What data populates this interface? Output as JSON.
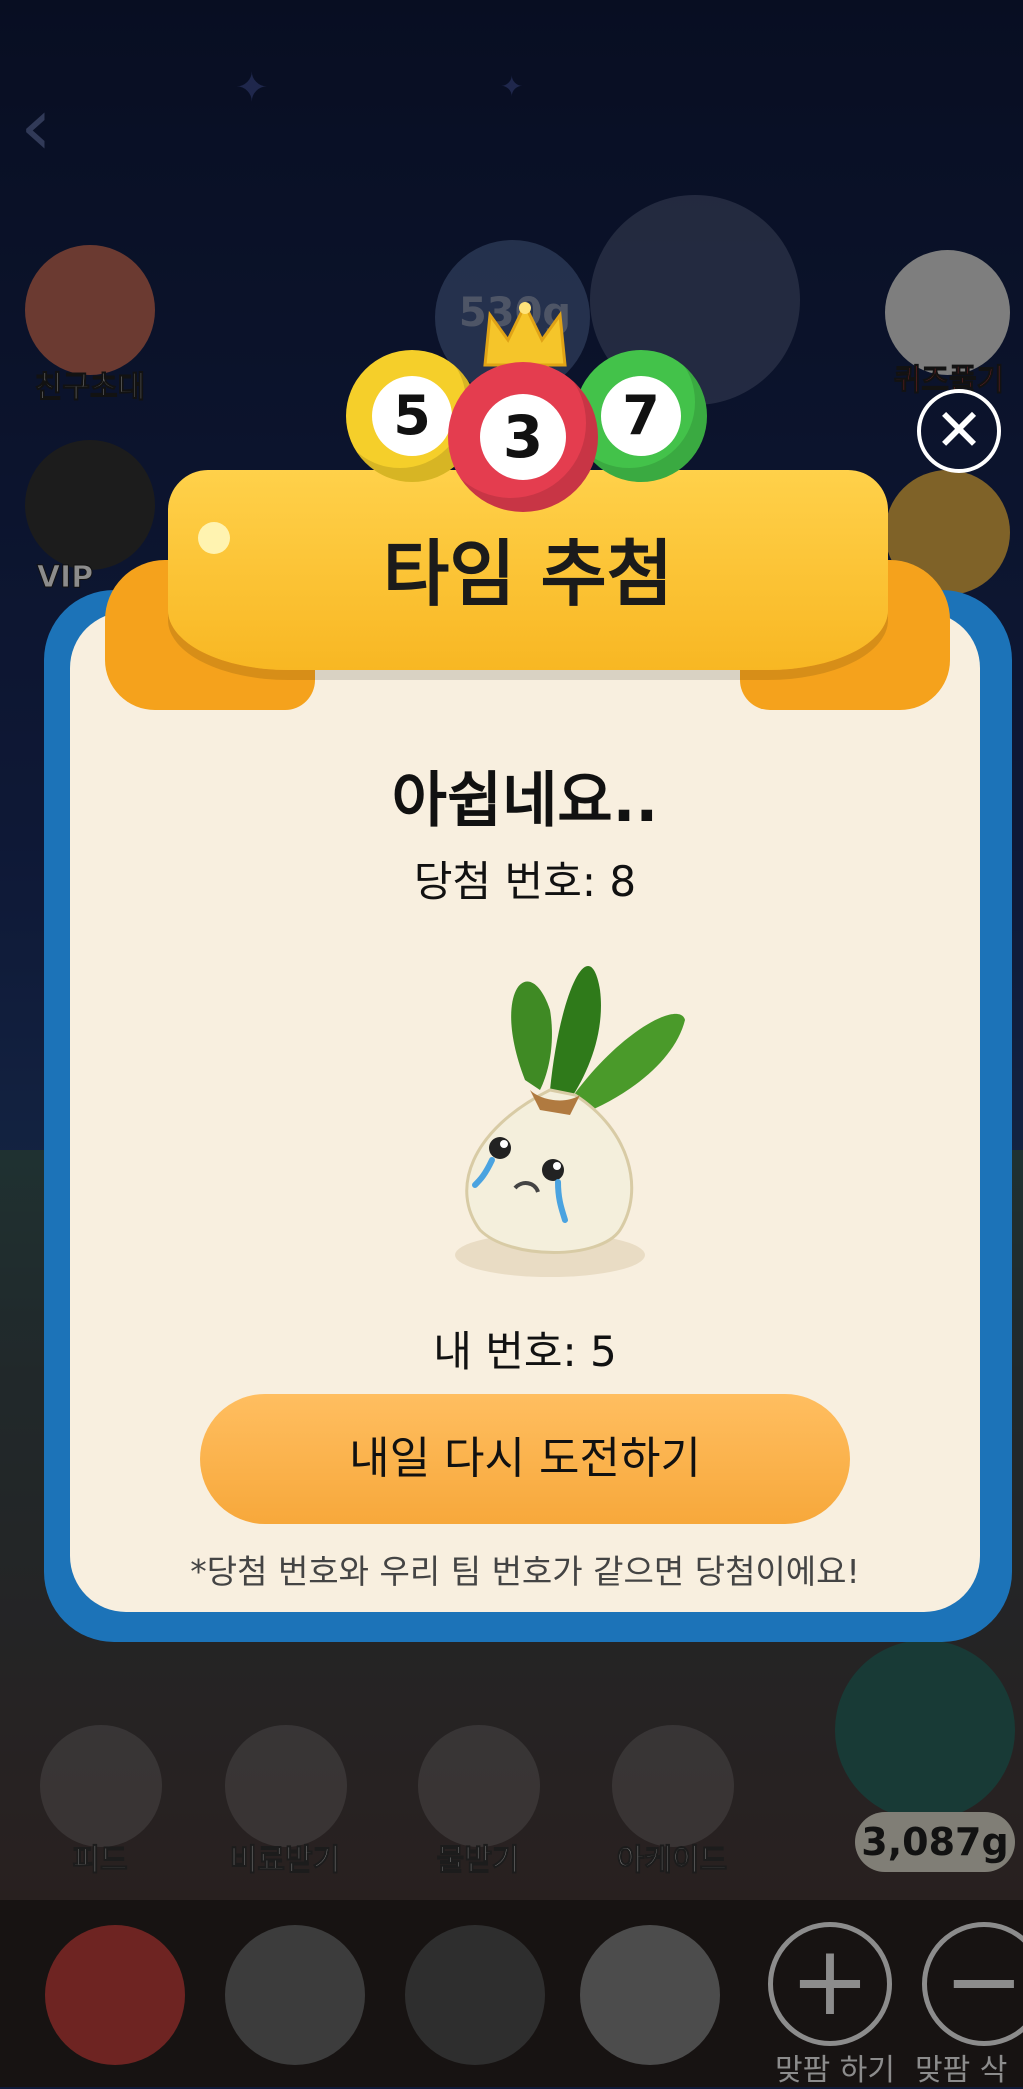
{
  "modal": {
    "title": "타임 추첨",
    "balls": [
      "5",
      "3",
      "7"
    ],
    "result_heading": "아쉽네요..",
    "winning_number_text": "당첨 번호: 8",
    "my_number_text": "내 번호: 5",
    "cta_label": "내일 다시 도전하기",
    "footnote": "*당첨 번호와 우리 팀 번호가 같으면 당첨이에요!",
    "close_icon": "close-icon"
  },
  "background": {
    "left_menu": [
      "친구초대",
      "VIP"
    ],
    "right_menu": [
      "퀴즈풀기"
    ],
    "jar_label": "530g",
    "weight_badge": "3,087g",
    "tiles": [
      "피드",
      "비료받기",
      "물받기",
      "아케이드"
    ],
    "bottom_buttons": [
      "맞팜 하기",
      "맞팜 삭"
    ]
  },
  "colors": {
    "modal_border": "#1c73b8",
    "modal_bg": "#f8efdf",
    "ribbon": "#f8b723",
    "cta": "#f7a83b",
    "ball_yellow": "#f5cf2a",
    "ball_red": "#e43d4f",
    "ball_green": "#43c24a"
  }
}
